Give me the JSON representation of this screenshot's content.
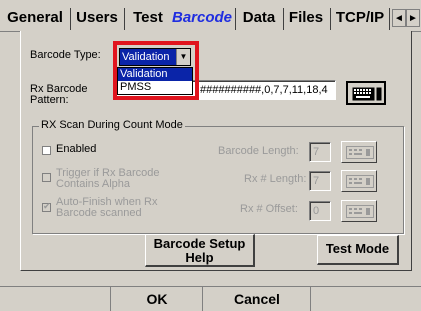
{
  "tabs": [
    {
      "label": "General",
      "active": false
    },
    {
      "label": "Users",
      "active": false
    },
    {
      "label": "Test",
      "active": false
    },
    {
      "label": "Barcode",
      "active": true
    },
    {
      "label": "Data",
      "active": false
    },
    {
      "label": "Files",
      "active": false
    },
    {
      "label": "TCP/IP",
      "active": false
    }
  ],
  "tab_scroll": {
    "left_icon": "◄",
    "right_icon": "►"
  },
  "barcode_type": {
    "label": "Barcode Type:",
    "value": "Validation",
    "options": [
      "Validation",
      "PMSS"
    ],
    "highlight_color": "#e0141e"
  },
  "rx_barcode_pattern": {
    "label_line1": "Rx Barcode",
    "label_line2": "Pattern:",
    "value": "##########,0,7,7,11,18,4",
    "keyboard_icon": "keyboard-icon"
  },
  "rx_scan_group": {
    "title": "RX Scan During Count Mode",
    "enabled_label": "Enabled",
    "trigger_label_line1": "Trigger if Rx Barcode",
    "trigger_label_line2": "Contains Alpha",
    "autofinish_label_line1": "Auto-Finish when Rx",
    "autofinish_label_line2": "Barcode scanned",
    "barcode_length_label": "Barcode Length:",
    "barcode_length_value": "7",
    "rx_length_label": "Rx # Length:",
    "rx_length_value": "7",
    "rx_offset_label": "Rx # Offset:",
    "rx_offset_value": "0",
    "keypad_icon": "numeric-keypad-icon"
  },
  "buttons": {
    "barcode_setup_help_line1": "Barcode Setup",
    "barcode_setup_help_line2": "Help",
    "test_mode": "Test Mode",
    "ok": "OK",
    "cancel": "Cancel"
  },
  "colors": {
    "background": "#d4d0c8",
    "active_tab": "#1f2de0",
    "selection": "#0a24a8"
  }
}
